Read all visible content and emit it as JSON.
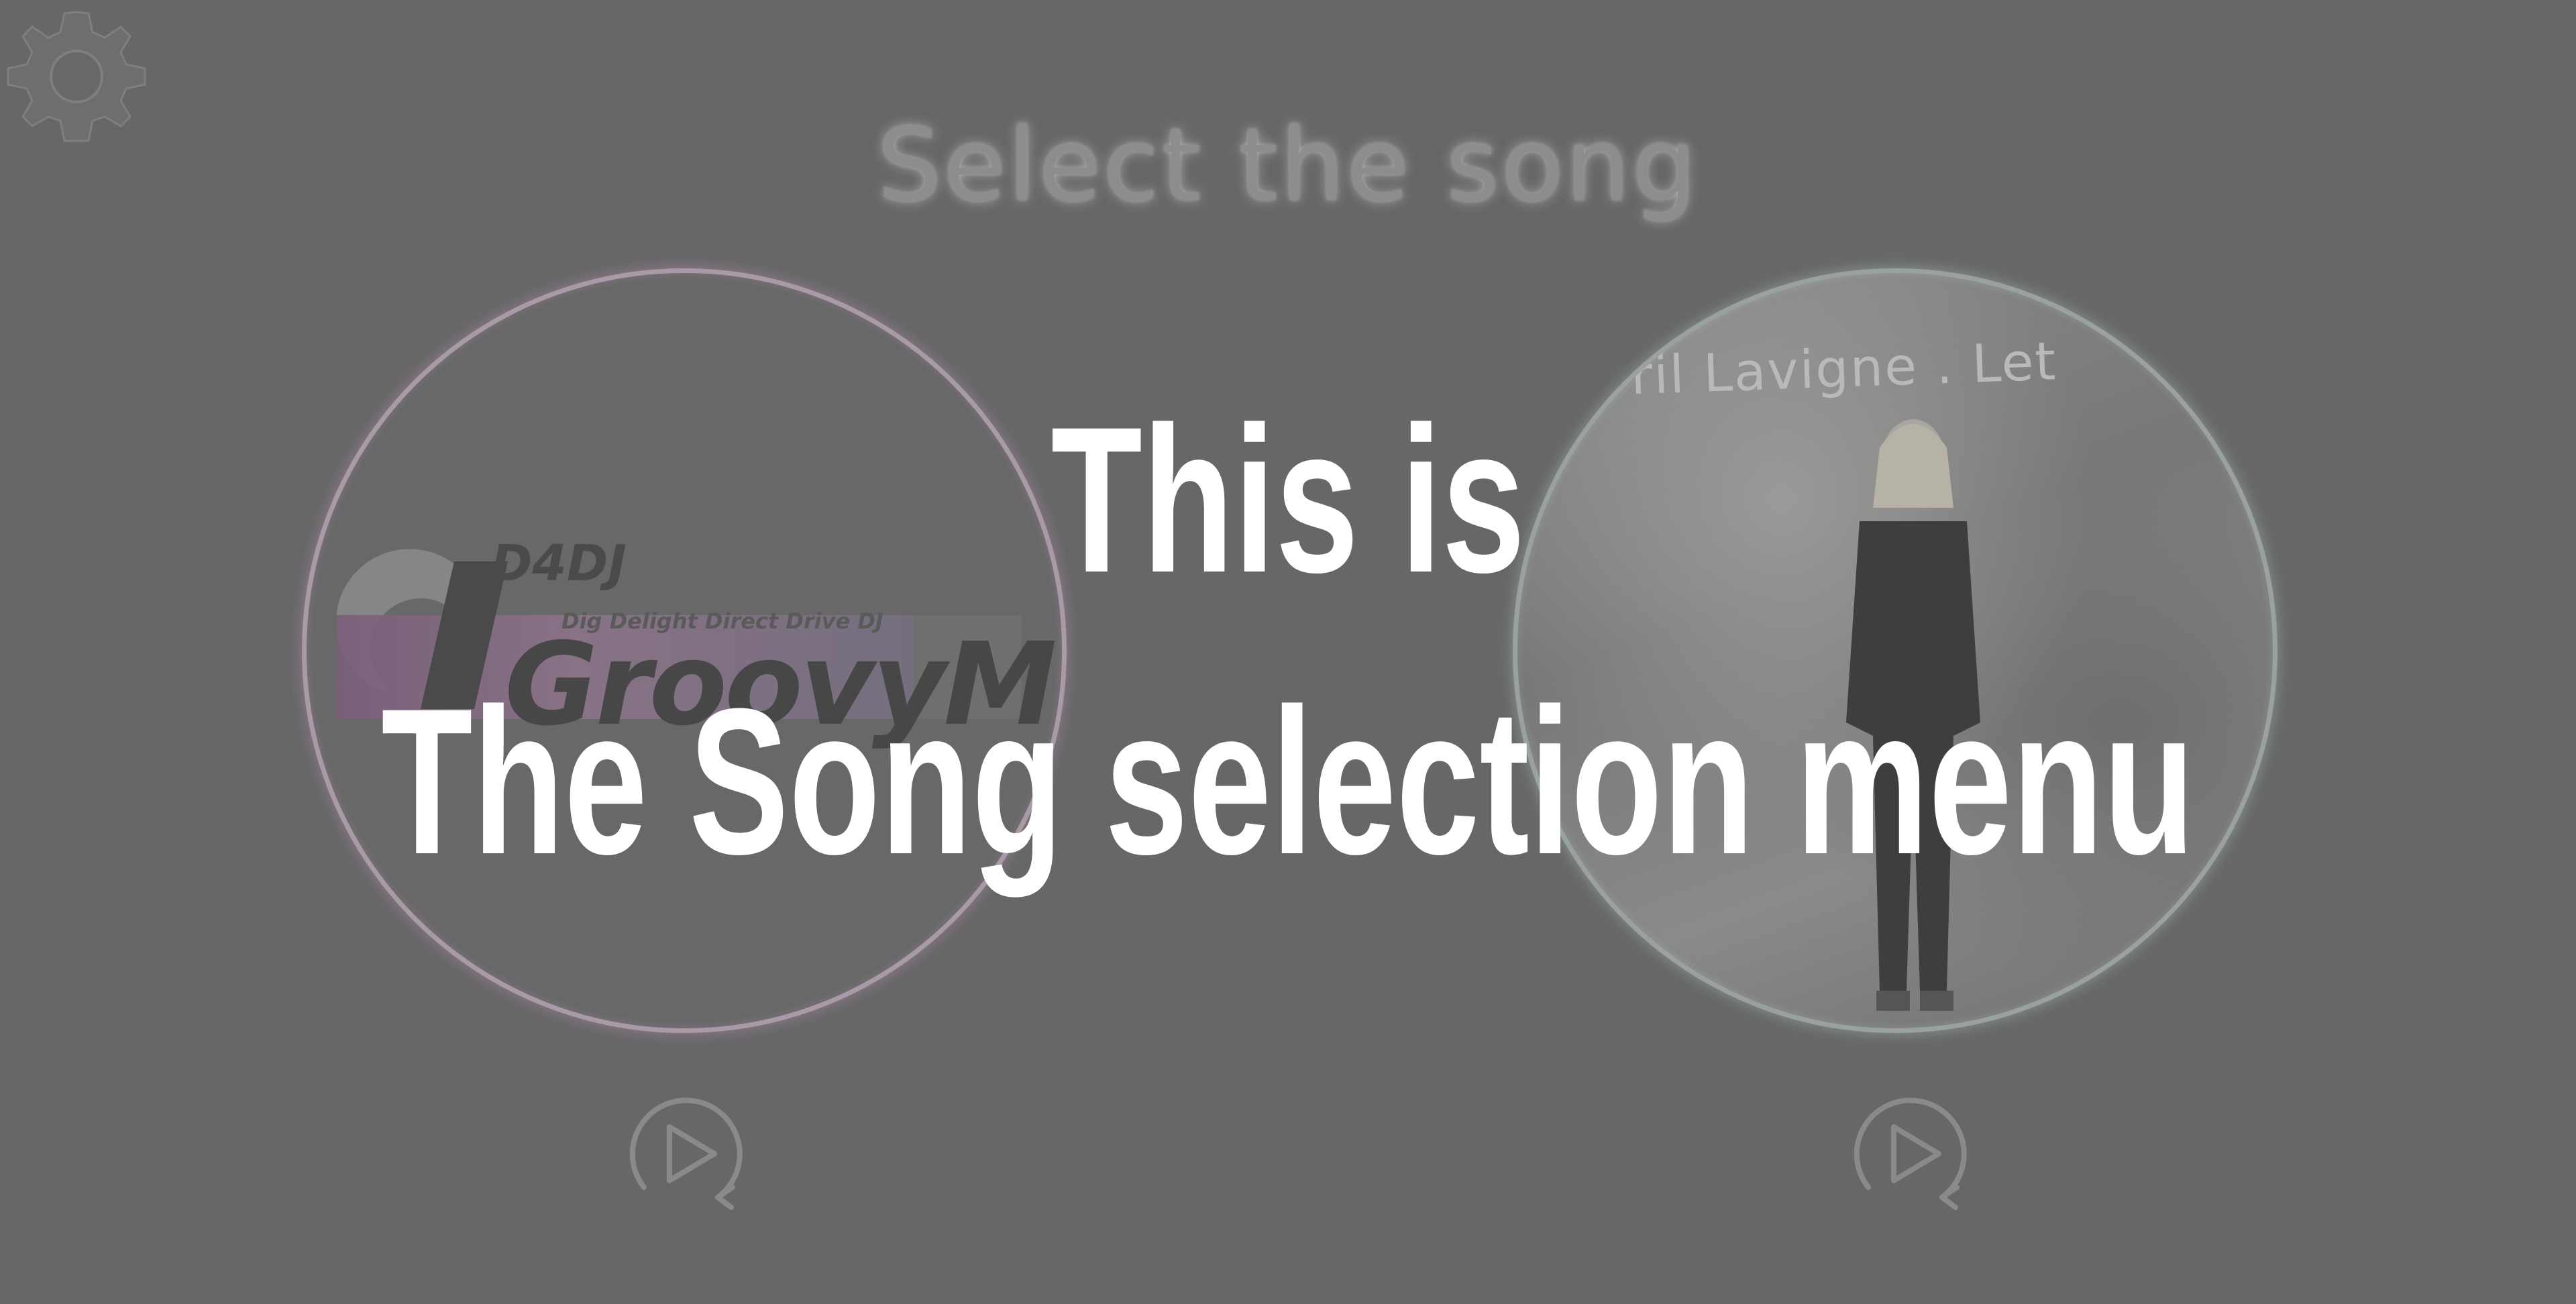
{
  "screen": {
    "title": "Select the song"
  },
  "overlay": {
    "line1": "This is",
    "line2": "The Song selection menu"
  },
  "songs": [
    {
      "logo_brand": "D4DJ",
      "logo_tagline": "Dig Delight Direct Drive DJ",
      "logo_title": "GroovyMix",
      "accent": "#c79ac7"
    },
    {
      "album_text": "Avril Lavigne . Let",
      "accent": "#a9c8b8"
    }
  ],
  "icons": {
    "settings": "gear-icon",
    "play": "play-replay-icon"
  },
  "colors": {
    "background": "#676767",
    "caption": "#ffffff",
    "title_glow": "#dcdcdc"
  }
}
